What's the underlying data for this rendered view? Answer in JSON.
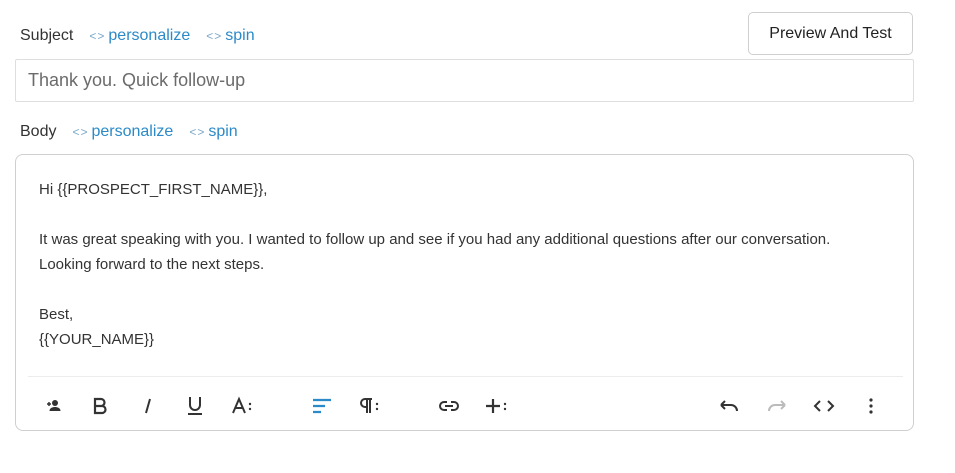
{
  "subject": {
    "label": "Subject",
    "personalize_label": "personalize",
    "spin_label": "spin",
    "value": "Thank you. Quick follow-up"
  },
  "preview_button_label": "Preview And Test",
  "body": {
    "label": "Body",
    "personalize_label": "personalize",
    "spin_label": "spin",
    "lines": [
      "Hi {{PROSPECT_FIRST_NAME}},",
      "It was great speaking with you. I wanted to follow up and see if you had any additional questions after our conversation.",
      "Looking forward to the next steps.",
      "Best,",
      "{{YOUR_NAME}}"
    ]
  },
  "toolbar": {
    "icons": [
      "add-person-icon",
      "bold-icon",
      "italic-icon",
      "underline-icon",
      "text-size-icon",
      "align-left-icon",
      "paragraph-icon",
      "link-icon",
      "insert-icon",
      "undo-icon",
      "redo-icon",
      "code-view-icon",
      "more-vertical-icon"
    ]
  },
  "colors": {
    "link": "#2b8ac8",
    "active_icon": "#2b8ac8",
    "icon": "#333333",
    "disabled_icon": "#bbbbbb"
  }
}
